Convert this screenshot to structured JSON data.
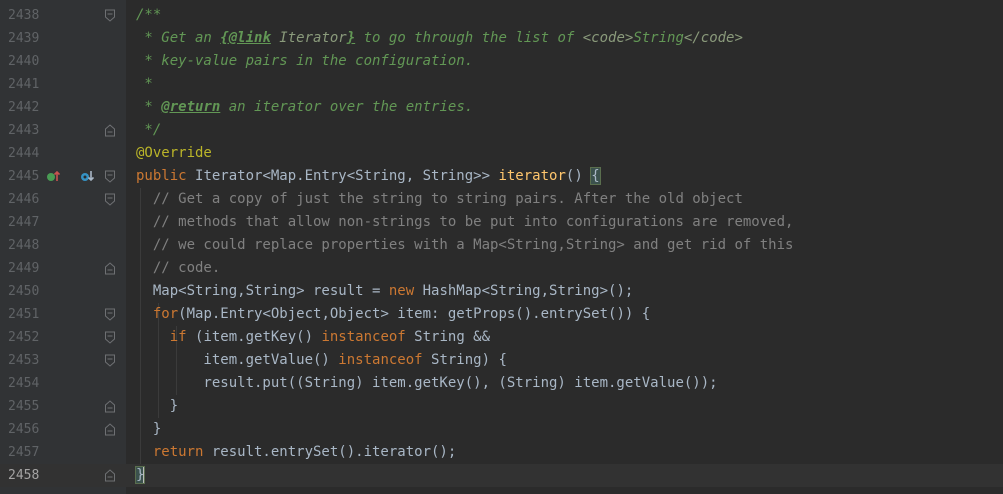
{
  "editor": {
    "lines": [
      {
        "n": "2438",
        "segs": [
          {
            "c": "tok-doc",
            "t": "/**"
          }
        ]
      },
      {
        "n": "2439",
        "segs": [
          {
            "c": "tok-doc",
            "t": " * Get an "
          },
          {
            "c": "tok-doclink",
            "t": "{@link"
          },
          {
            "c": "tok-docplain",
            "t": " Iterator"
          },
          {
            "c": "tok-doclink",
            "t": "}"
          },
          {
            "c": "tok-doc",
            "t": " to go through the list of "
          },
          {
            "c": "tok-docplain",
            "t": "<code>"
          },
          {
            "c": "tok-doc",
            "t": "String"
          },
          {
            "c": "tok-docplain",
            "t": "</code>"
          }
        ]
      },
      {
        "n": "2440",
        "segs": [
          {
            "c": "tok-doc",
            "t": " * key-value pairs in the configuration."
          }
        ]
      },
      {
        "n": "2441",
        "segs": [
          {
            "c": "tok-doc",
            "t": " *"
          }
        ]
      },
      {
        "n": "2442",
        "segs": [
          {
            "c": "tok-doc",
            "t": " * "
          },
          {
            "c": "tok-doctag",
            "t": "@return"
          },
          {
            "c": "tok-doc",
            "t": " an iterator over the entries."
          }
        ]
      },
      {
        "n": "2443",
        "segs": [
          {
            "c": "tok-doc",
            "t": " */"
          }
        ]
      },
      {
        "n": "2444",
        "segs": [
          {
            "c": "tok-ann",
            "t": "@Override"
          }
        ]
      },
      {
        "n": "2445",
        "segs": [
          {
            "c": "tok-kw",
            "t": "public "
          },
          {
            "c": "tok-id",
            "t": "Iterator<Map.Entry<String, String>> "
          },
          {
            "c": "tok-fn",
            "t": "iterator"
          },
          {
            "c": "tok-id",
            "t": "() "
          },
          {
            "c": "tok-brace-hl",
            "t": "{"
          }
        ]
      },
      {
        "n": "2446",
        "segs": [
          {
            "c": "tok-cm",
            "t": "  // Get a copy of just the string to string pairs. After the old object"
          }
        ]
      },
      {
        "n": "2447",
        "segs": [
          {
            "c": "tok-cm",
            "t": "  // methods that allow non-strings to be put into configurations are removed,"
          }
        ]
      },
      {
        "n": "2448",
        "segs": [
          {
            "c": "tok-cm",
            "t": "  // we could replace properties with a Map<String,String> and get rid of this"
          }
        ]
      },
      {
        "n": "2449",
        "segs": [
          {
            "c": "tok-cm",
            "t": "  // code."
          }
        ]
      },
      {
        "n": "2450",
        "segs": [
          {
            "c": "tok-id",
            "t": "  Map<String,String> result = "
          },
          {
            "c": "tok-kw",
            "t": "new "
          },
          {
            "c": "tok-id",
            "t": "HashMap<String,String>();"
          }
        ]
      },
      {
        "n": "2451",
        "segs": [
          {
            "c": "tok-kw",
            "t": "  for"
          },
          {
            "c": "tok-id",
            "t": "(Map.Entry<Object,Object> item: getProps().entrySet()) {"
          }
        ]
      },
      {
        "n": "2452",
        "segs": [
          {
            "c": "tok-kw",
            "t": "    if "
          },
          {
            "c": "tok-id",
            "t": "(item.getKey() "
          },
          {
            "c": "tok-kw",
            "t": "instanceof "
          },
          {
            "c": "tok-id",
            "t": "String &&"
          }
        ]
      },
      {
        "n": "2453",
        "segs": [
          {
            "c": "tok-id",
            "t": "        item.getValue() "
          },
          {
            "c": "tok-kw",
            "t": "instanceof "
          },
          {
            "c": "tok-id",
            "t": "String) {"
          }
        ]
      },
      {
        "n": "2454",
        "segs": [
          {
            "c": "tok-id",
            "t": "        result.put((String) item.getKey(), (String) item.getValue());"
          }
        ]
      },
      {
        "n": "2455",
        "segs": [
          {
            "c": "tok-id",
            "t": "    }"
          }
        ]
      },
      {
        "n": "2456",
        "segs": [
          {
            "c": "tok-id",
            "t": "  }"
          }
        ]
      },
      {
        "n": "2457",
        "segs": [
          {
            "c": "tok-kw",
            "t": "  return "
          },
          {
            "c": "tok-id",
            "t": "result.entrySet().iterator();"
          }
        ]
      },
      {
        "n": "2458",
        "segs": [
          {
            "c": "tok-brace-hl",
            "t": "}"
          }
        ],
        "current": true
      }
    ],
    "gutter_icons": {
      "2445": [
        "override-icon",
        "implements-icon"
      ]
    },
    "fold_markers": [
      "2438",
      "2443",
      "2445",
      "2446",
      "2449",
      "2451",
      "2452",
      "2453",
      "2455",
      "2456",
      "2458"
    ],
    "colors": {
      "background": "#2b2b2b",
      "gutter": "#313335",
      "line_number": "#606366",
      "keyword": "#cc7832",
      "doc_comment": "#629755",
      "comment": "#808080",
      "annotation": "#bbb529",
      "method": "#ffc66d",
      "text": "#a9b7c6"
    }
  }
}
